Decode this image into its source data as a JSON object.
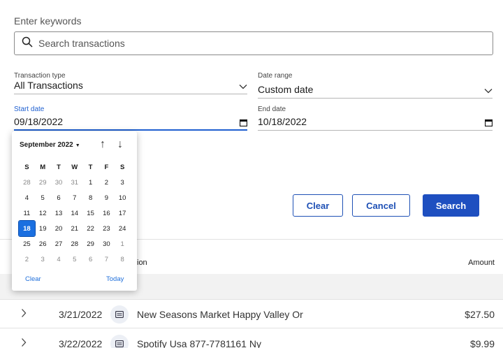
{
  "search": {
    "label": "Enter keywords",
    "placeholder": "Search transactions"
  },
  "filters": {
    "transaction_type_label": "Transaction type",
    "transaction_type_value": "All Transactions",
    "date_range_label": "Date range",
    "date_range_value": "Custom date",
    "start_date_label": "Start date",
    "start_date_value": "09/18/2022",
    "end_date_label": "End date",
    "end_date_value": "10/18/2022"
  },
  "buttons": {
    "clear": "Clear",
    "cancel": "Cancel",
    "search": "Search"
  },
  "calendar": {
    "month": "September 2022",
    "days_of_week": [
      "S",
      "M",
      "T",
      "W",
      "T",
      "F",
      "S"
    ],
    "weeks": [
      [
        "28",
        "29",
        "30",
        "31",
        "1",
        "2",
        "3"
      ],
      [
        "4",
        "5",
        "6",
        "7",
        "8",
        "9",
        "10"
      ],
      [
        "11",
        "12",
        "13",
        "14",
        "15",
        "16",
        "17"
      ],
      [
        "18",
        "19",
        "20",
        "21",
        "22",
        "23",
        "24"
      ],
      [
        "25",
        "26",
        "27",
        "28",
        "29",
        "30",
        "1"
      ],
      [
        "2",
        "3",
        "4",
        "5",
        "6",
        "7",
        "8"
      ]
    ],
    "selected_day": "18",
    "clear_label": "Clear",
    "today_label": "Today"
  },
  "table": {
    "description_header_fragment": "ion",
    "amount_header": "Amount",
    "rows": [
      {
        "date": "3/21/2022",
        "description": "New Seasons Market Happy Valley Or",
        "amount": "$27.50"
      },
      {
        "date": "3/22/2022",
        "description": "Spotify Usa 877-7781161 Ny",
        "amount": "$9.99"
      }
    ]
  },
  "colors": {
    "primary": "#1e4fc0",
    "selected_day": "#1a6fe0",
    "link": "#1f6fdb"
  }
}
